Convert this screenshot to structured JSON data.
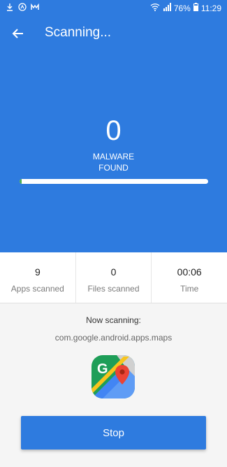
{
  "status_bar": {
    "battery": "76%",
    "time": "11:29"
  },
  "header": {
    "title": "Scanning..."
  },
  "scan": {
    "malware_count": "0",
    "malware_label_line1": "MALWARE",
    "malware_label_line2": "FOUND",
    "progress_fraction": 0.01
  },
  "stats": [
    {
      "value": "9",
      "label": "Apps scanned"
    },
    {
      "value": "0",
      "label": "Files scanned"
    },
    {
      "value": "00:06",
      "label": "Time"
    }
  ],
  "now_scanning": {
    "label": "Now scanning:",
    "package": "com.google.android.apps.maps",
    "icon": "google-maps-icon"
  },
  "actions": {
    "stop_label": "Stop"
  },
  "colors": {
    "primary": "#2e7bdf",
    "progress": "#4caf50"
  }
}
